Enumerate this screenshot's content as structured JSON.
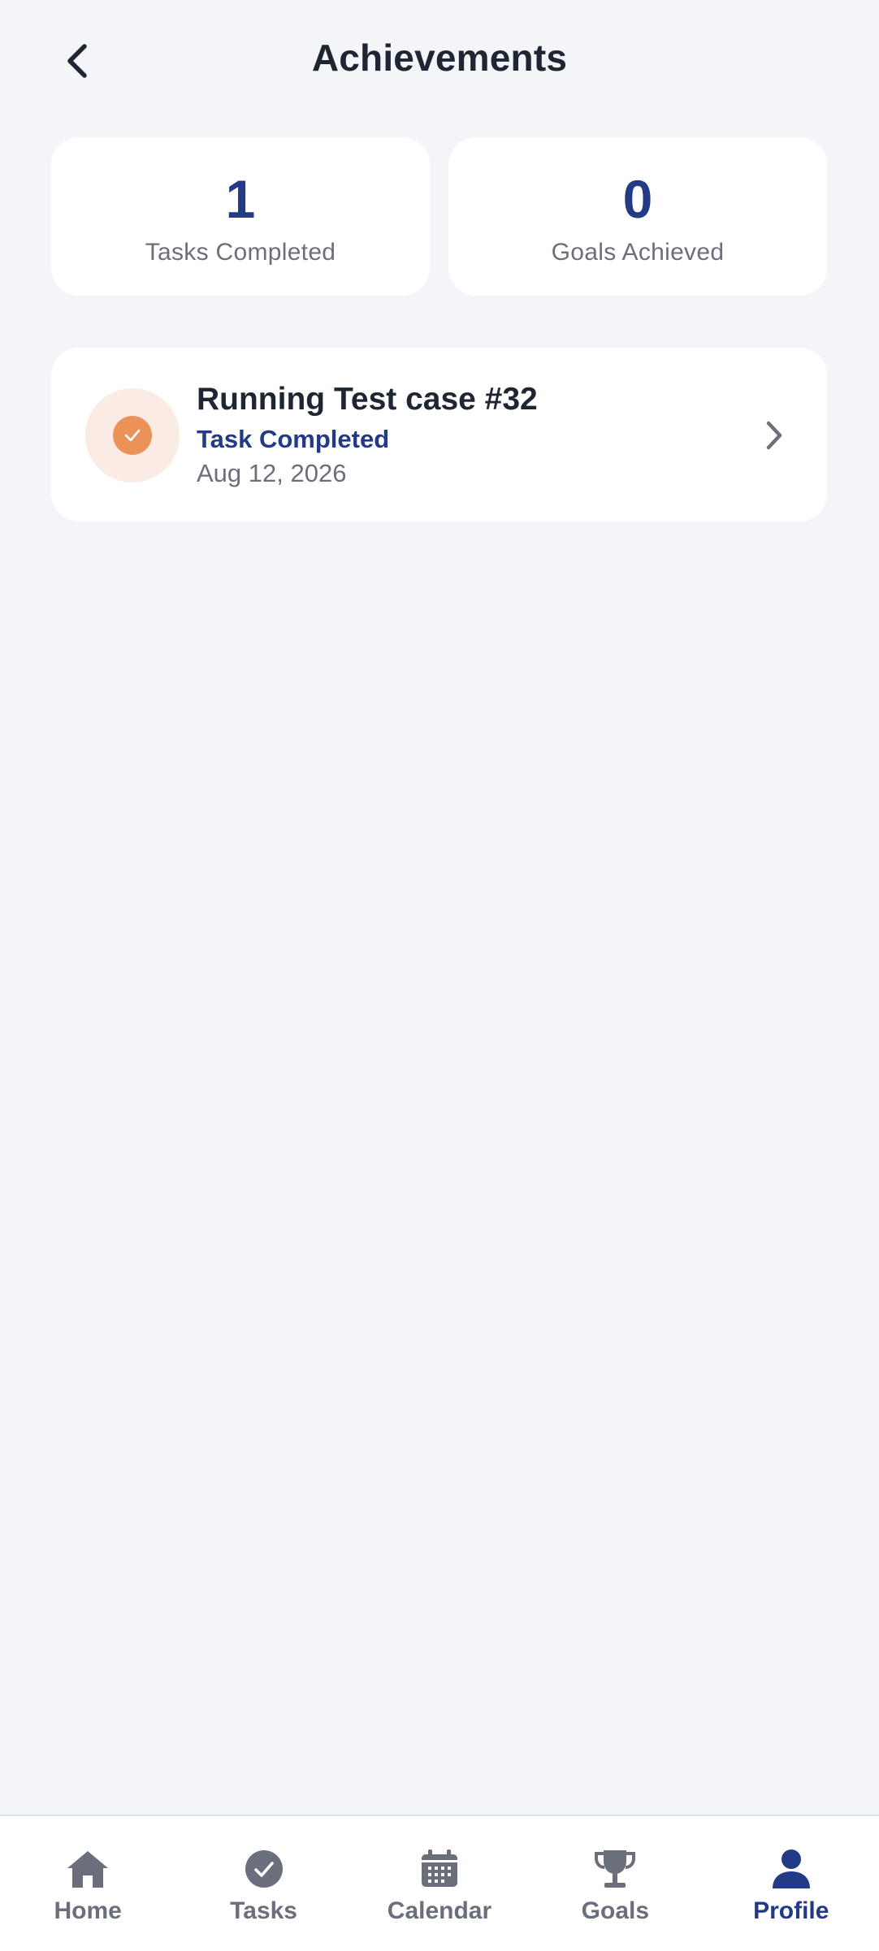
{
  "header": {
    "title": "Achievements",
    "back_icon": "chevron-left-icon"
  },
  "stats": [
    {
      "value": "1",
      "label": "Tasks Completed"
    },
    {
      "value": "0",
      "label": "Goals Achieved"
    }
  ],
  "achievements": [
    {
      "icon": "check-circle-icon",
      "title": "Running Test case #32",
      "status": "Task Completed",
      "date": "Aug 12, 2026"
    }
  ],
  "nav": {
    "items": [
      {
        "label": "Home",
        "icon": "home-icon"
      },
      {
        "label": "Tasks",
        "icon": "check-circle-icon"
      },
      {
        "label": "Calendar",
        "icon": "calendar-icon"
      },
      {
        "label": "Goals",
        "icon": "trophy-icon"
      },
      {
        "label": "Profile",
        "icon": "person-icon"
      }
    ],
    "active": "Profile"
  },
  "colors": {
    "background": "#f3f5f9",
    "card": "#ffffff",
    "accent": "#233a86",
    "badge": "#eb9258",
    "badge_bg": "#faece4",
    "muted": "#6a6f7b",
    "nav_inactive": "#6a6f7b"
  }
}
